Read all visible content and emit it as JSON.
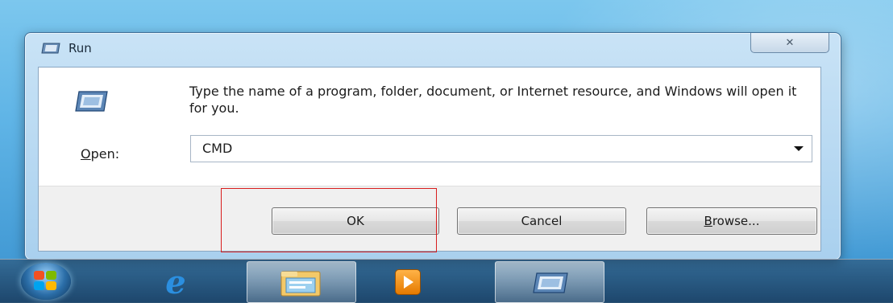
{
  "window": {
    "title": "Run",
    "description": "Type the name of a program, folder, document, or Internet resource, and Windows will open it for you.",
    "open_label_underlined": "O",
    "open_label_rest": "pen:",
    "open_value": "CMD",
    "buttons": {
      "ok": "OK",
      "cancel": "Cancel",
      "browse_underlined": "B",
      "browse_rest": "rowse..."
    }
  },
  "highlight_color": "#d81e1e",
  "taskbar": {
    "items": [
      "start-button",
      "internet-explorer",
      "windows-explorer",
      "media-player",
      "run"
    ]
  }
}
